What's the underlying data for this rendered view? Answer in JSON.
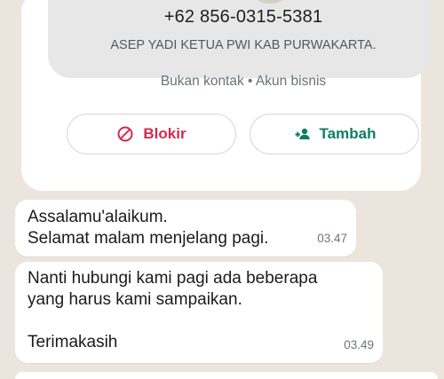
{
  "profile": {
    "phone": "+62 856-0315-5381",
    "about": "ASEP YADI KETUA PWI KAB PURWAKARTA.",
    "meta": "Bukan kontak • Akun bisnis"
  },
  "actions": {
    "block_label": "Blokir",
    "block_icon": "block-icon",
    "add_label": "Tambah",
    "add_icon": "add-contact-icon"
  },
  "messages": [
    {
      "lines": [
        "Assalamu'alaikum.",
        "Selamat malam menjelang pagi."
      ],
      "time": "03.47"
    },
    {
      "lines": [
        "Nanti hubungi kami pagi ada beberapa",
        "yang harus kami sampaikan.",
        "",
        "Terimakasih"
      ],
      "time": "03.49"
    }
  ],
  "colors": {
    "chat_bg": "#ece5dd",
    "block_red": "#d12b51",
    "add_green": "#0f7f62"
  }
}
